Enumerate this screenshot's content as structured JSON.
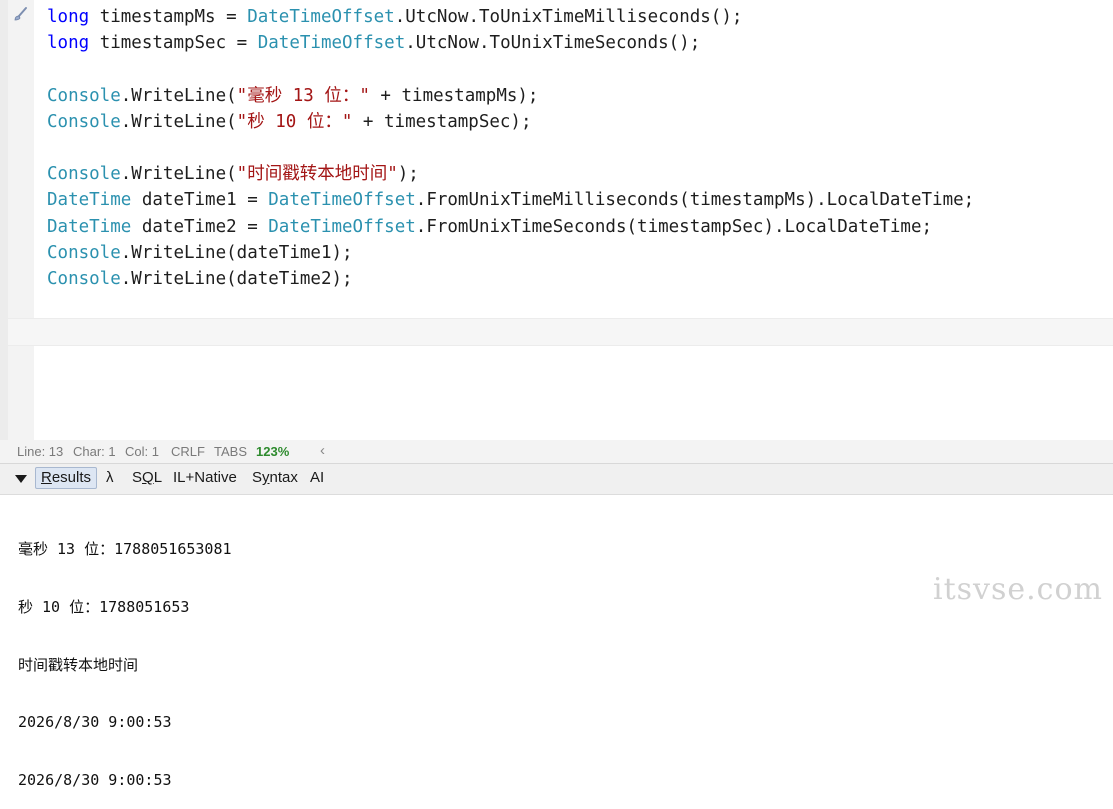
{
  "editor": {
    "lines": [
      [
        {
          "t": "long",
          "c": "kw"
        },
        {
          "t": " timestampMs = ",
          "c": ""
        },
        {
          "t": "DateTimeOffset",
          "c": "typ"
        },
        {
          "t": ".UtcNow.ToUnixTimeMilliseconds();",
          "c": ""
        }
      ],
      [
        {
          "t": "long",
          "c": "kw"
        },
        {
          "t": " timestampSec = ",
          "c": ""
        },
        {
          "t": "DateTimeOffset",
          "c": "typ"
        },
        {
          "t": ".UtcNow.ToUnixTimeSeconds();",
          "c": ""
        }
      ],
      [],
      [
        {
          "t": "Console",
          "c": "typ"
        },
        {
          "t": ".WriteLine(",
          "c": ""
        },
        {
          "t": "\"毫秒 13 位：\"",
          "c": "str"
        },
        {
          "t": " + timestampMs);",
          "c": ""
        }
      ],
      [
        {
          "t": "Console",
          "c": "typ"
        },
        {
          "t": ".WriteLine(",
          "c": ""
        },
        {
          "t": "\"秒 10 位：\"",
          "c": "str"
        },
        {
          "t": " + timestampSec);",
          "c": ""
        }
      ],
      [],
      [
        {
          "t": "Console",
          "c": "typ"
        },
        {
          "t": ".WriteLine(",
          "c": ""
        },
        {
          "t": "\"时间戳转本地时间\"",
          "c": "str"
        },
        {
          "t": ");",
          "c": ""
        }
      ],
      [
        {
          "t": "DateTime",
          "c": "typ"
        },
        {
          "t": " dateTime1 = ",
          "c": ""
        },
        {
          "t": "DateTimeOffset",
          "c": "typ"
        },
        {
          "t": ".FromUnixTimeMilliseconds(timestampMs).LocalDateTime;",
          "c": ""
        }
      ],
      [
        {
          "t": "DateTime",
          "c": "typ"
        },
        {
          "t": " dateTime2 = ",
          "c": ""
        },
        {
          "t": "DateTimeOffset",
          "c": "typ"
        },
        {
          "t": ".FromUnixTimeSeconds(timestampSec).LocalDateTime;",
          "c": ""
        }
      ],
      [
        {
          "t": "Console",
          "c": "typ"
        },
        {
          "t": ".WriteLine(dateTime1);",
          "c": ""
        }
      ],
      [
        {
          "t": "Console",
          "c": "typ"
        },
        {
          "t": ".WriteLine(dateTime2);",
          "c": ""
        }
      ]
    ],
    "colors": {
      "keyword": "#0000ff",
      "type": "#2b91af",
      "string": "#a31515",
      "text": "#1e1e1e"
    },
    "gutter_icon": "brush-icon"
  },
  "status": {
    "line": "Line: 13",
    "char": "Char: 1",
    "col": "Col: 1",
    "eol": "CRLF",
    "indent": "TABS",
    "zoom": "123%",
    "collapse_icon": "‹"
  },
  "results_tabs": {
    "expand_icon": "triangle-down-icon",
    "results": "Results",
    "lambda": "λ",
    "sql": "SQL",
    "il": "IL+Native",
    "syntax": "Syntax",
    "ai": "AI"
  },
  "output": {
    "lines": [
      "毫秒 13 位：1788051653081",
      "秒 10 位：1788051653",
      "时间戳转本地时间",
      "2026/8/30 9:00:53",
      "2026/8/30 9:00:53"
    ]
  },
  "watermark": "itsvse.com"
}
